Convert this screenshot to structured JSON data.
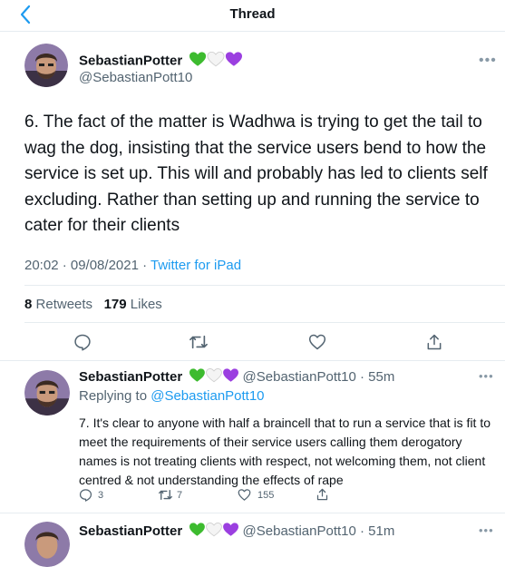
{
  "header": {
    "title": "Thread"
  },
  "main_tweet": {
    "name": "SebastianPotter",
    "handle": "@SebastianPott10",
    "text": "6.  The fact of the matter is Wadhwa is trying to get the tail to wag the dog, insisting that the service users bend to how the service is set up.   This will and probably has led to clients self excluding. Rather than setting up and running the service to cater for their clients",
    "time": "20:02 · 09/08/2021",
    "sep": " · ",
    "source": "Twitter for iPad",
    "retweets": "8",
    "retweets_label": "Retweets",
    "likes": "179",
    "likes_label": "Likes"
  },
  "replies": [
    {
      "name": "SebastianPotter",
      "handle_time": "@SebastianPott10 · 55m",
      "replying_prefix": "Replying to ",
      "replying_handle": "@SebastianPott10",
      "text": "7. It's clear to anyone with half a braincell that to run a service that is fit to meet the requirements of their service users calling them derogatory names is not treating clients with respect, not welcoming them, not client centred & not understanding the effects of rape",
      "reply_count": "3",
      "retweet_count": "7",
      "like_count": "155"
    },
    {
      "name": "SebastianPotter",
      "handle_time": "@SebastianPott10 · 51m"
    }
  ],
  "icons": [
    "back-chevron-icon",
    "green-heart-icon",
    "white-heart-icon",
    "purple-heart-icon",
    "more-icon",
    "reply-icon",
    "retweet-icon",
    "like-icon",
    "share-icon"
  ],
  "colors": {
    "accent": "#1d9bf0",
    "muted": "#536471",
    "green_heart": "#3dbb2f",
    "purple_heart": "#9b3fe0"
  }
}
